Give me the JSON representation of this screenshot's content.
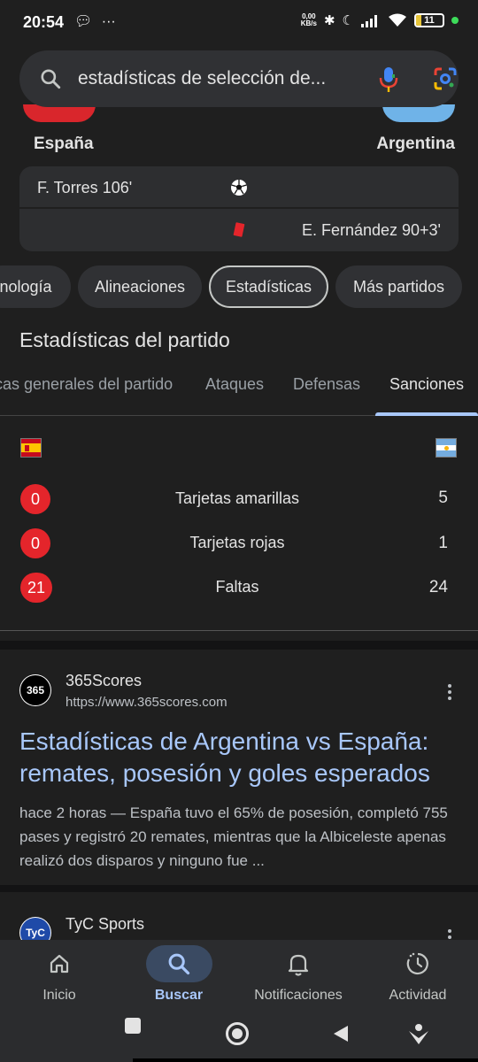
{
  "status_bar": {
    "time": "20:54",
    "net_speed_top": "0,00",
    "net_speed_bottom": "KB/s",
    "battery": "11"
  },
  "search": {
    "query": "estadísticas de selección de..."
  },
  "teams": {
    "home": "España",
    "away": "Argentina"
  },
  "events": [
    {
      "side": "home",
      "text": "F. Torres 106'",
      "icon": "soccer-ball-icon"
    },
    {
      "side": "away",
      "text": "E. Fernández 90+3'",
      "icon": "red-card-icon"
    }
  ],
  "chips": [
    "nología",
    "Alineaciones",
    "Estadísticas",
    "Más partidos"
  ],
  "active_chip": "Estadísticas",
  "section_title": "Estadísticas del partido",
  "tabs": [
    "cas generales del partido",
    "Ataques",
    "Defensas",
    "Sanciones"
  ],
  "selected_tab": "Sanciones",
  "stats": [
    {
      "label": "Tarjetas amarillas",
      "home": "0",
      "away": "5"
    },
    {
      "label": "Tarjetas rojas",
      "home": "0",
      "away": "1"
    },
    {
      "label": "Faltas",
      "home": "21",
      "away": "24"
    }
  ],
  "results": [
    {
      "site": "365Scores",
      "url": "https://www.365scores.com",
      "favicon_text": "365",
      "title": "Estadísticas de Argentina vs España: remates, posesión y goles esperados",
      "snippet": "hace 2 horas — España tuvo el 65% de posesión, completó 755 pases y registró 20 remates, mientras que la Albiceleste apenas realizó dos disparos y ninguno fue ..."
    },
    {
      "site": "TyC Sports",
      "favicon_text": "TyC"
    }
  ],
  "bottom_nav": [
    {
      "label": "Inicio",
      "icon": "home-icon"
    },
    {
      "label": "Buscar",
      "icon": "search-icon"
    },
    {
      "label": "Notificaciones",
      "icon": "bell-icon"
    },
    {
      "label": "Actividad",
      "icon": "activity-icon"
    }
  ],
  "colors": {
    "background": "#1f1f1f",
    "card": "#2d2e30",
    "accent_blue": "#a8c7fa",
    "red_pill": "#e4252b"
  }
}
